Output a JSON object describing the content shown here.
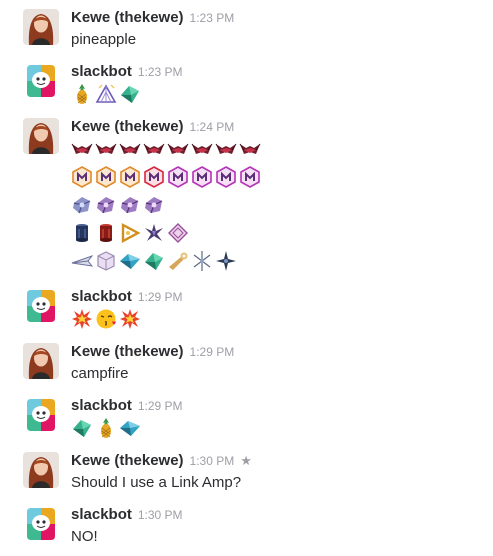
{
  "messages": [
    {
      "sender": "Kewe (thekewe)",
      "time": "1:23 PM",
      "text": "pineapple"
    },
    {
      "sender": "slackbot",
      "time": "1:23 PM",
      "emoji": [
        "pineapple-emoji",
        "pyramid-emoji",
        "gem-ship-emoji"
      ]
    },
    {
      "sender": "Kewe (thekewe)",
      "time": "1:24 PM",
      "emoji_rows": [
        [
          "ship-red-emoji",
          "ship-red-emoji",
          "ship-red-emoji",
          "ship-red-emoji",
          "ship-red-emoji",
          "ship-red-emoji",
          "ship-red-emoji",
          "ship-red-emoji"
        ],
        [
          "hex-badge-gold-emoji",
          "hex-badge-gold-emoji",
          "hex-badge-gold-emoji",
          "hex-badge-red-emoji",
          "hex-badge-magenta-emoji",
          "hex-badge-magenta-emoji",
          "hex-badge-magenta-emoji",
          "hex-badge-magenta-emoji"
        ],
        [
          "crystal-blue-emoji",
          "crystal-purple-emoji",
          "crystal-purple-emoji",
          "crystal-purple-emoji"
        ],
        [
          "cylinder-blue-emoji",
          "cylinder-red-emoji",
          "triangle-gold-emoji",
          "shard-purple-emoji",
          "diamond-pink-emoji"
        ],
        [
          "arrow-ship-emoji",
          "cube-emoji",
          "teal-ship-emoji",
          "green-ship-emoji",
          "wrench-emoji",
          "spark-emoji",
          "star-ship-emoji"
        ]
      ]
    },
    {
      "sender": "slackbot",
      "time": "1:29 PM",
      "emoji": [
        "collision-emoji",
        "kissing-face-emoji",
        "collision-emoji"
      ]
    },
    {
      "sender": "Kewe (thekewe)",
      "time": "1:29 PM",
      "text": "campfire"
    },
    {
      "sender": "slackbot",
      "time": "1:29 PM",
      "emoji": [
        "gem-ship-emoji",
        "pineapple-emoji",
        "teal-ship-emoji"
      ]
    },
    {
      "sender": "Kewe (thekewe)",
      "time": "1:30 PM",
      "star": "★",
      "text": "Should I use a Link Amp?"
    },
    {
      "sender": "slackbot",
      "time": "1:30 PM",
      "text": "NO!"
    }
  ],
  "colors": {
    "text": "#2c2d30",
    "timestamp": "#9e9ea6"
  }
}
